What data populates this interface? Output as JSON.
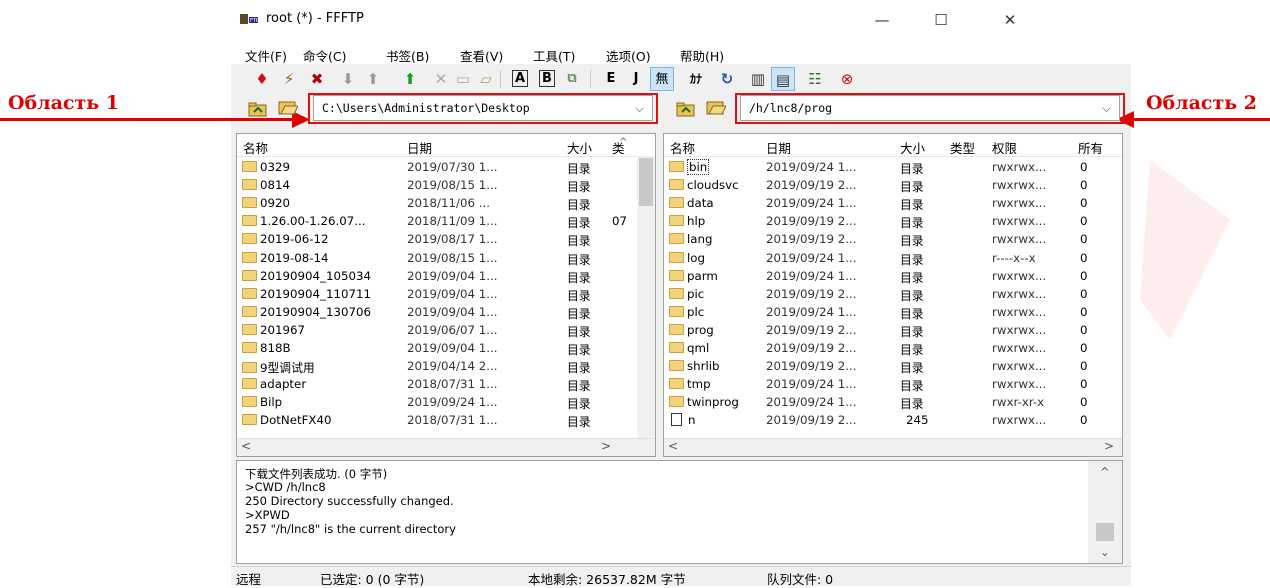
{
  "window": {
    "title": "root (*) - FFFTP",
    "controls": {
      "minimize": "—",
      "maximize": "☐",
      "close": "✕"
    }
  },
  "menu": [
    "文件(F)",
    "命令(C)",
    "书签(B)",
    "查看(V)",
    "工具(T)",
    "选项(O)",
    "帮助(H)"
  ],
  "toolbar": {
    "icons": [
      "connect-icon",
      "quick-connect-icon",
      "disconnect-icon",
      "download-icon",
      "upload-icon",
      "mirror-upload-icon",
      "delete-icon",
      "rename-icon",
      "mkdir-icon",
      "ascii-mode-icon",
      "binary-mode-icon",
      "auto-mode-icon",
      "euc-icon",
      "jis-icon",
      "no-convert-icon",
      "kana-icon",
      "refresh-icon",
      "list-view-icon",
      "detail-view-icon",
      "directory-sync-icon",
      "stop-icon"
    ],
    "labels": {
      "a": "A",
      "b": "B",
      "euc": "E",
      "jis": "J",
      "none": "無",
      "kana": "ｶﾅ"
    }
  },
  "annotations": {
    "left": "Область 1",
    "right": "Область 2"
  },
  "local": {
    "path": "C:\\Users\\Administrator\\Desktop",
    "headers": {
      "name": "名称",
      "date": "日期",
      "size": "大小",
      "type": "类"
    },
    "rows": [
      {
        "name": "0329",
        "date": "2019/07/30 1...",
        "size": "目录",
        "type": ""
      },
      {
        "name": "0814",
        "date": "2019/08/15 1...",
        "size": "目录",
        "type": ""
      },
      {
        "name": "0920",
        "date": "2018/11/06 ...",
        "size": "目录",
        "type": ""
      },
      {
        "name": "1.26.00-1.26.07...",
        "date": "2018/11/09 1...",
        "size": "目录",
        "type": "07"
      },
      {
        "name": "2019-06-12",
        "date": "2019/08/17 1...",
        "size": "目录",
        "type": ""
      },
      {
        "name": "2019-08-14",
        "date": "2019/08/15 1...",
        "size": "目录",
        "type": ""
      },
      {
        "name": "20190904_105034",
        "date": "2019/09/04 1...",
        "size": "目录",
        "type": ""
      },
      {
        "name": "20190904_110711",
        "date": "2019/09/04 1...",
        "size": "目录",
        "type": ""
      },
      {
        "name": "20190904_130706",
        "date": "2019/09/04 1...",
        "size": "目录",
        "type": ""
      },
      {
        "name": "201967",
        "date": "2019/06/07 1...",
        "size": "目录",
        "type": ""
      },
      {
        "name": "818B",
        "date": "2019/09/04 1...",
        "size": "目录",
        "type": ""
      },
      {
        "name": "9型调试用",
        "date": "2019/04/14 2...",
        "size": "目录",
        "type": ""
      },
      {
        "name": "adapter",
        "date": "2018/07/31 1...",
        "size": "目录",
        "type": ""
      },
      {
        "name": "Bilp",
        "date": "2019/09/24 1...",
        "size": "目录",
        "type": ""
      },
      {
        "name": "DotNetFX40",
        "date": "2018/07/31 1...",
        "size": "目录",
        "type": ""
      }
    ]
  },
  "remote": {
    "path": "/h/lnc8/prog",
    "headers": {
      "name": "名称",
      "date": "日期",
      "size": "大小",
      "type": "类型",
      "perm": "权限",
      "owner": "所有"
    },
    "rows": [
      {
        "name": "bin",
        "date": "2019/09/24 1...",
        "size": "目录",
        "perm": "rwxrwx...",
        "owner": "0",
        "kind": "dir"
      },
      {
        "name": "cloudsvc",
        "date": "2019/09/19 2...",
        "size": "目录",
        "perm": "rwxrwx...",
        "owner": "0",
        "kind": "dir"
      },
      {
        "name": "data",
        "date": "2019/09/24 1...",
        "size": "目录",
        "perm": "rwxrwx...",
        "owner": "0",
        "kind": "dir"
      },
      {
        "name": "hlp",
        "date": "2019/09/19 2...",
        "size": "目录",
        "perm": "rwxrwx...",
        "owner": "0",
        "kind": "dir"
      },
      {
        "name": "lang",
        "date": "2019/09/19 2...",
        "size": "目录",
        "perm": "rwxrwx...",
        "owner": "0",
        "kind": "dir"
      },
      {
        "name": "log",
        "date": "2019/09/24 1...",
        "size": "目录",
        "perm": "r----x--x",
        "owner": "0",
        "kind": "dir"
      },
      {
        "name": "parm",
        "date": "2019/09/24 1...",
        "size": "目录",
        "perm": "rwxrwx...",
        "owner": "0",
        "kind": "dir"
      },
      {
        "name": "pic",
        "date": "2019/09/19 2...",
        "size": "目录",
        "perm": "rwxrwx...",
        "owner": "0",
        "kind": "dir"
      },
      {
        "name": "plc",
        "date": "2019/09/24 1...",
        "size": "目录",
        "perm": "rwxrwx...",
        "owner": "0",
        "kind": "dir"
      },
      {
        "name": "prog",
        "date": "2019/09/19 2...",
        "size": "目录",
        "perm": "rwxrwx...",
        "owner": "0",
        "kind": "dir"
      },
      {
        "name": "qml",
        "date": "2019/09/19 2...",
        "size": "目录",
        "perm": "rwxrwx...",
        "owner": "0",
        "kind": "dir"
      },
      {
        "name": "shrlib",
        "date": "2019/09/19 2...",
        "size": "目录",
        "perm": "rwxrwx...",
        "owner": "0",
        "kind": "dir"
      },
      {
        "name": "tmp",
        "date": "2019/09/24 1...",
        "size": "目录",
        "perm": "rwxrwx...",
        "owner": "0",
        "kind": "dir"
      },
      {
        "name": "twinprog",
        "date": "2019/09/24 1...",
        "size": "目录",
        "perm": "rwxr-xr-x",
        "owner": "0",
        "kind": "dir"
      },
      {
        "name": "n",
        "date": "2019/09/19 2...",
        "size": "245",
        "perm": "rwxrwx...",
        "owner": "0",
        "kind": "file"
      }
    ]
  },
  "log": [
    "下载文件列表成功. (0 字节)",
    ">CWD /h/lnc8",
    "250 Directory successfully changed.",
    ">XPWD",
    "257 \"/h/lnc8\" is the current directory"
  ],
  "status": {
    "mode": "远程",
    "selected": "已选定: 0 (0 字节)",
    "free": "本地剩余: 26537.82M 字节",
    "queue": "队列文件: 0"
  }
}
